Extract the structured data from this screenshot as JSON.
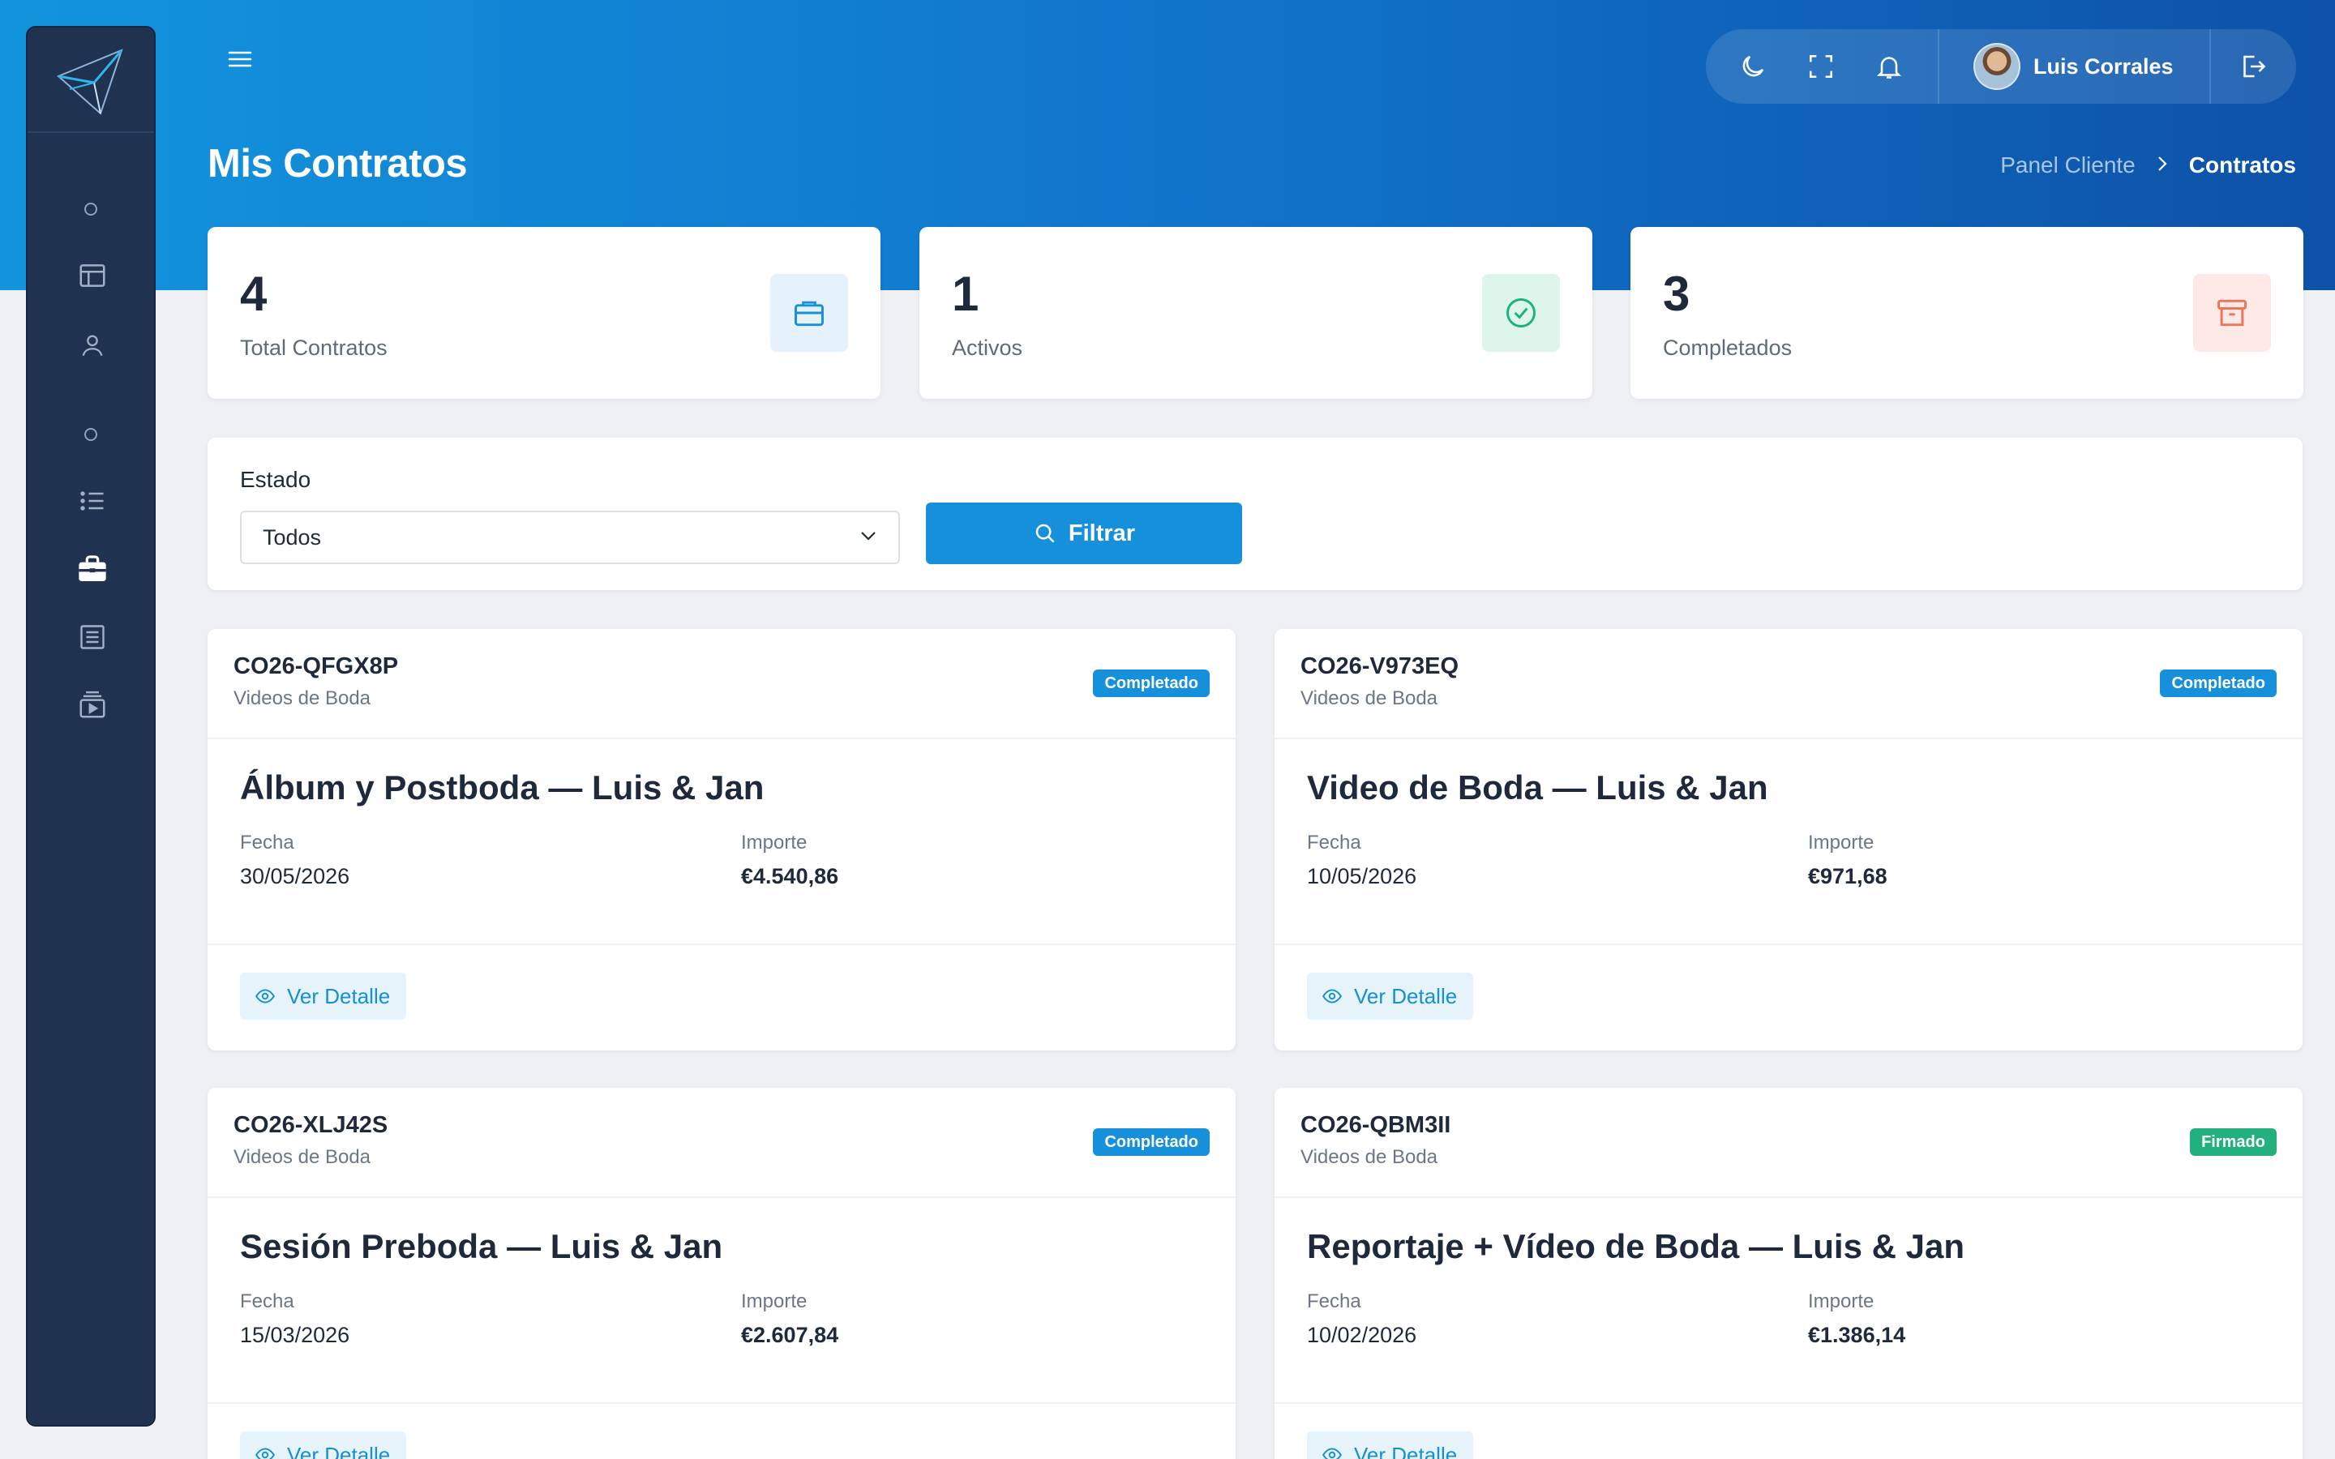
{
  "header": {
    "title": "Mis Contratos",
    "breadcrumb": {
      "parent": "Panel Cliente",
      "current": "Contratos"
    },
    "user_name": "Luis Corrales",
    "icons": [
      "menu-icon",
      "moon-icon",
      "fullscreen-icon",
      "bell-icon",
      "logout-icon"
    ]
  },
  "sidebar": {
    "icons": [
      "layout-icon",
      "user-icon",
      "list-icon",
      "briefcase-icon",
      "document-icon",
      "video-library-icon"
    ],
    "active": "briefcase-icon"
  },
  "stats": [
    {
      "value": "4",
      "label": "Total Contratos",
      "icon": "briefcase-icon",
      "color": "#1690db"
    },
    {
      "value": "1",
      "label": "Activos",
      "icon": "check-circle-icon",
      "color": "#1bb37a"
    },
    {
      "value": "3",
      "label": "Completados",
      "icon": "archive-icon",
      "color": "#f0735a"
    }
  ],
  "filter": {
    "label": "Estado",
    "selected": "Todos",
    "button": "Filtrar"
  },
  "contracts": [
    {
      "code": "CO26-QFGX8P",
      "category": "Videos de Boda",
      "status": "Completado",
      "title": "Álbum y Postboda — Luis & Jan",
      "date_label": "Fecha",
      "date": "30/05/2026",
      "amount_label": "Importe",
      "amount": "€4.540,86",
      "action": "Ver Detalle"
    },
    {
      "code": "CO26-V973EQ",
      "category": "Videos de Boda",
      "status": "Completado",
      "title": "Video de Boda — Luis & Jan",
      "date_label": "Fecha",
      "date": "10/05/2026",
      "amount_label": "Importe",
      "amount": "€971,68",
      "action": "Ver Detalle"
    },
    {
      "code": "CO26-XLJ42S",
      "category": "Videos de Boda",
      "status": "Completado",
      "title": "Sesión Preboda — Luis & Jan",
      "date_label": "Fecha",
      "date": "15/03/2026",
      "amount_label": "Importe",
      "amount": "€2.607,84",
      "action": "Ver Detalle"
    },
    {
      "code": "CO26-QBM3II",
      "category": "Videos de Boda",
      "status": "Firmado",
      "title": "Reportaje + Vídeo de Boda — Luis & Jan",
      "date_label": "Fecha",
      "date": "10/02/2026",
      "amount_label": "Importe",
      "amount": "€1.386,14",
      "action": "Ver Detalle"
    }
  ],
  "colors": {
    "completado": "#1690db",
    "firmado": "#22b07d",
    "sidebar": "#1f3350",
    "accent": "#1690db"
  }
}
